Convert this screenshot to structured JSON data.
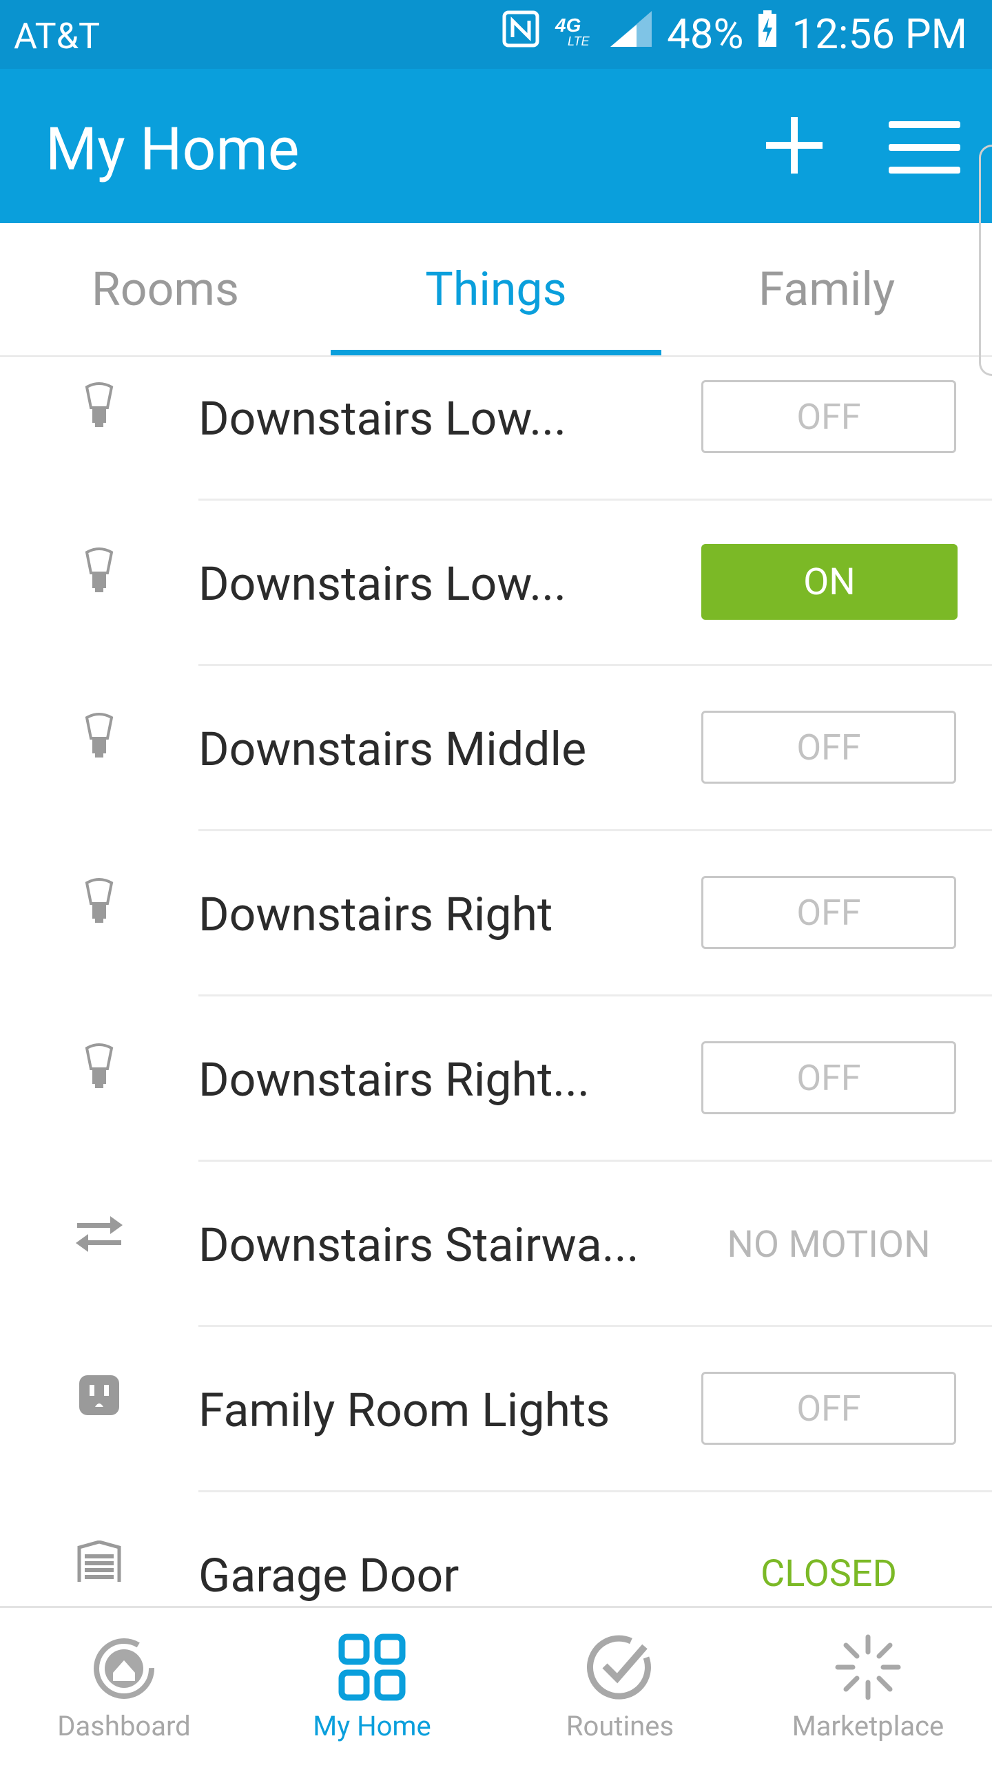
{
  "statusbar": {
    "carrier": "AT&T",
    "battery": "48%",
    "time": "12:56 PM",
    "network": "4G LTE"
  },
  "appbar": {
    "title": "My Home"
  },
  "tabs": [
    {
      "label": "Rooms"
    },
    {
      "label": "Things"
    },
    {
      "label": "Family"
    }
  ],
  "things": [
    {
      "name": "Downstairs Low...",
      "icon": "bulb-icon",
      "state": "OFF"
    },
    {
      "name": "Downstairs Low...",
      "icon": "bulb-icon",
      "state": "ON"
    },
    {
      "name": "Downstairs Middle",
      "icon": "bulb-icon",
      "state": "OFF"
    },
    {
      "name": "Downstairs Right",
      "icon": "bulb-icon",
      "state": "OFF"
    },
    {
      "name": "Downstairs Right...",
      "icon": "bulb-icon",
      "state": "OFF"
    },
    {
      "name": "Downstairs Stairwa...",
      "icon": "motion-sensor-icon",
      "state": "NO MOTION"
    },
    {
      "name": "Family Room Lights",
      "icon": "outlet-icon",
      "state": "OFF"
    },
    {
      "name": "Garage Door",
      "icon": "garage-door-icon",
      "state": "CLOSED"
    }
  ],
  "bottom_nav": [
    {
      "label": "Dashboard",
      "icon": "dashboard-icon"
    },
    {
      "label": "My Home",
      "icon": "grid-icon"
    },
    {
      "label": "Routines",
      "icon": "routines-icon"
    },
    {
      "label": "Marketplace",
      "icon": "marketplace-icon"
    }
  ],
  "colors": {
    "primary": "#0a9fdc",
    "status_bar": "#0a93cf",
    "on_green": "#7bb926"
  }
}
